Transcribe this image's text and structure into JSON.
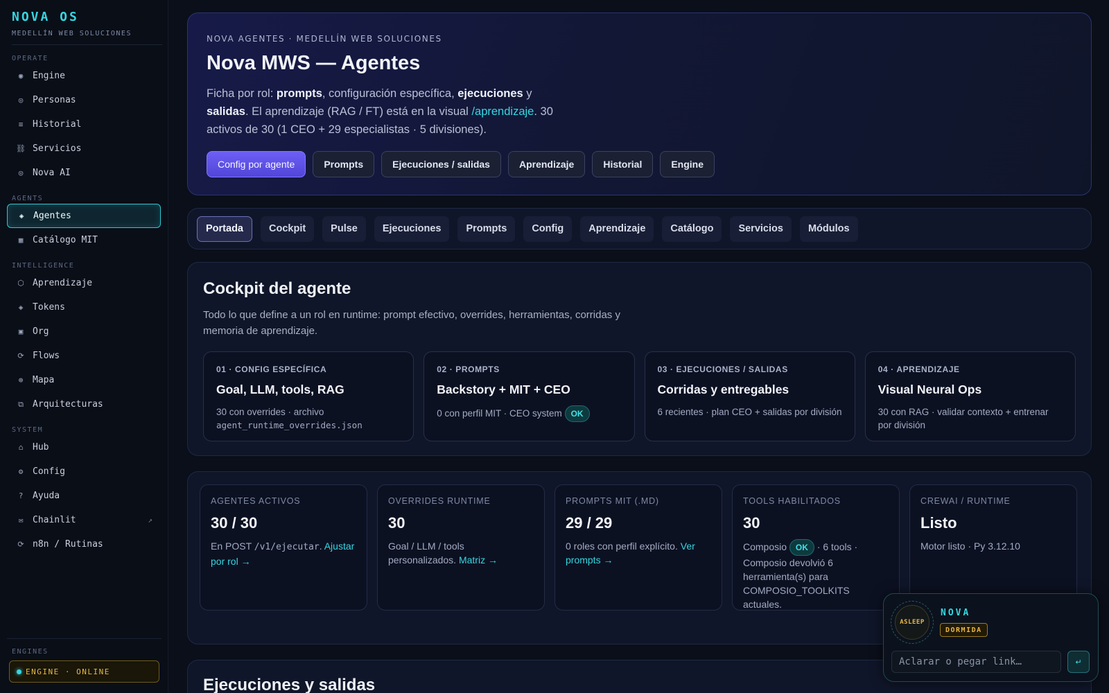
{
  "sidebar": {
    "brand": "NOVA OS",
    "subtitle": "MEDELLÍN WEB SOLUCIONES",
    "sections": [
      {
        "label": "OPERATE",
        "items": [
          {
            "icon": "◉",
            "label": "Engine"
          },
          {
            "icon": "◎",
            "label": "Personas"
          },
          {
            "icon": "≡",
            "label": "Historial"
          },
          {
            "icon": "⛓",
            "label": "Servicios"
          },
          {
            "icon": "◎",
            "label": "Nova AI"
          }
        ]
      },
      {
        "label": "AGENTS",
        "items": [
          {
            "icon": "◈",
            "label": "Agentes"
          },
          {
            "icon": "▦",
            "label": "Catálogo MIT"
          }
        ]
      },
      {
        "label": "INTELLIGENCE",
        "items": [
          {
            "icon": "⬡",
            "label": "Aprendizaje"
          },
          {
            "icon": "◈",
            "label": "Tokens"
          },
          {
            "icon": "▣",
            "label": "Org"
          },
          {
            "icon": "⟳",
            "label": "Flows"
          },
          {
            "icon": "⊕",
            "label": "Mapa"
          },
          {
            "icon": "⧉",
            "label": "Arquitecturas"
          }
        ]
      },
      {
        "label": "SYSTEM",
        "items": [
          {
            "icon": "⌂",
            "label": "Hub"
          },
          {
            "icon": "⚙",
            "label": "Config"
          },
          {
            "icon": "?",
            "label": "Ayuda"
          },
          {
            "icon": "✉",
            "label": "Chainlit",
            "ext": "↗"
          },
          {
            "icon": "⟳",
            "label": "n8n / Rutinas"
          }
        ]
      }
    ],
    "engines_label": "ENGINES",
    "engine_status": "ENGINE · ONLINE"
  },
  "hero": {
    "eyebrow": "NOVA AGENTES · MEDELLÍN WEB SOLUCIONES",
    "title": "Nova MWS — Agentes",
    "desc": {
      "t1": "Ficha por rol: ",
      "b1": "prompts",
      "t2": ", configuración específica, ",
      "b2": "ejecuciones",
      "t3": " y ",
      "b3": "salidas",
      "t4": ". El aprendizaje (RAG / FT) está en la visual ",
      "link": "/aprendizaje",
      "t5": ". 30 activos de 30 (1 CEO + 29 especialistas · 5 divisiones)."
    },
    "buttons": [
      "Config por agente",
      "Prompts",
      "Ejecuciones / salidas",
      "Aprendizaje",
      "Historial",
      "Engine"
    ]
  },
  "tabs": [
    "Portada",
    "Cockpit",
    "Pulse",
    "Ejecuciones",
    "Prompts",
    "Config",
    "Aprendizaje",
    "Catálogo",
    "Servicios",
    "Módulos"
  ],
  "cockpit": {
    "title": "Cockpit del agente",
    "desc": "Todo lo que define a un rol en runtime: prompt efectivo, overrides, herramientas, corridas y memoria de aprendizaje.",
    "steps": [
      {
        "tag": "01 · CONFIG ESPECÍFICA",
        "title": "Goal, LLM, tools, RAG",
        "text": "30 con overrides · archivo",
        "mono": "agent_runtime_overrides.json"
      },
      {
        "tag": "02 · PROMPTS",
        "title": "Backstory + MIT + CEO",
        "text": "0 con perfil MIT · CEO system",
        "pill": "OK"
      },
      {
        "tag": "03 · EJECUCIONES / SALIDAS",
        "title": "Corridas y entregables",
        "text": "6 recientes · plan CEO + salidas por división"
      },
      {
        "tag": "04 · APRENDIZAJE",
        "title": "Visual Neural Ops",
        "text": "30 con RAG · validar contexto + entrenar por división"
      }
    ]
  },
  "stats": [
    {
      "label": "AGENTES ACTIVOS",
      "value": "30 / 30",
      "t1": "En POST ",
      "mono": "/v1/ejecutar",
      "t2": ". ",
      "link": "Ajustar por rol →"
    },
    {
      "label": "OVERRIDES RUNTIME",
      "value": "30",
      "t1": "Goal / LLM / tools personalizados. ",
      "link": "Matriz →"
    },
    {
      "label": "PROMPTS MIT (.MD)",
      "value": "29 / 29",
      "t1": "0 roles con perfil explícito. ",
      "link": "Ver prompts →"
    },
    {
      "label": "TOOLS HABILITADOS",
      "value": "30",
      "t1": "Composio ",
      "pill": "OK",
      "t2": " · 6 tools · Composio devolvió 6 herramienta(s) para COMPOSIO_TOOLKITS actuales."
    },
    {
      "label": "CREWAI / RUNTIME",
      "value": "Listo",
      "t1": "Motor listo · Py 3.12.10"
    }
  ],
  "executions": {
    "title": "Ejecuciones y salidas"
  },
  "nova": {
    "orb_label": "ASLEEP",
    "name": "NOVA",
    "status": "DORMIDA",
    "placeholder": "Aclarar o pegar link…",
    "send_icon": "↵"
  },
  "colors": {
    "accent": "#36d6e0",
    "primary": "#6d5ef5",
    "warning": "#e2b84a"
  }
}
